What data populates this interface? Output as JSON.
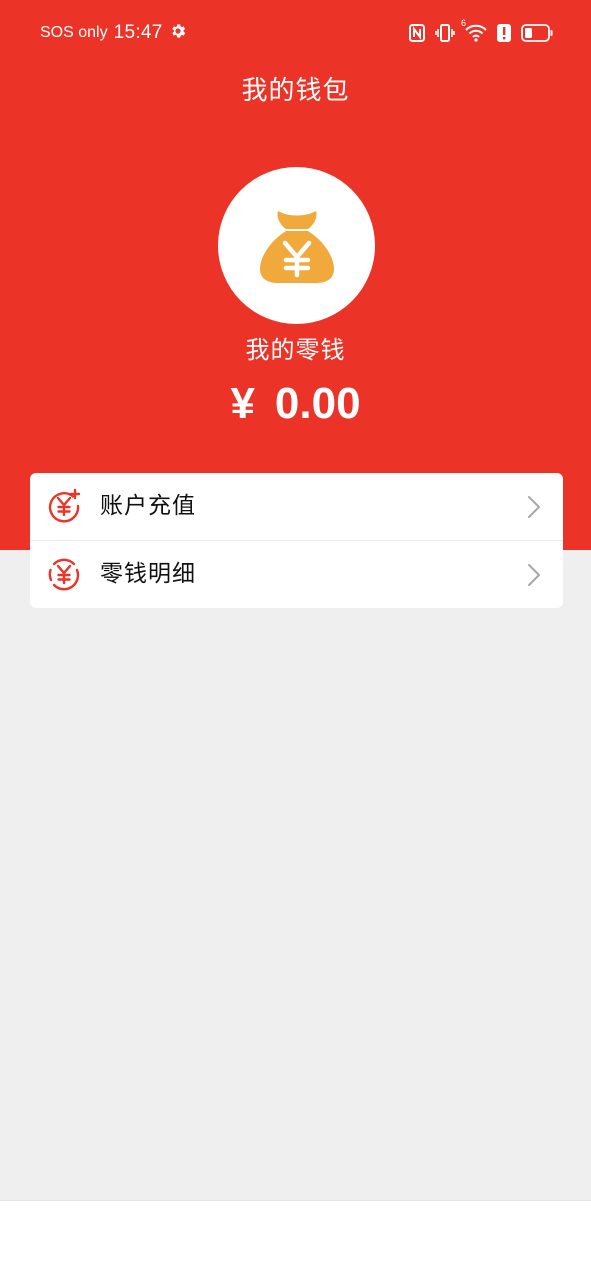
{
  "status_bar": {
    "carrier": "SOS only",
    "time": "15:47",
    "network_superscript": "6"
  },
  "header": {
    "title": "我的钱包"
  },
  "wallet": {
    "label": "我的零钱",
    "currency_symbol": "¥",
    "balance": "0.00"
  },
  "menu": {
    "items": [
      {
        "label": "账户充值",
        "icon": "yen-plus-icon"
      },
      {
        "label": "零钱明细",
        "icon": "yen-circle-icon"
      }
    ]
  },
  "colors": {
    "primary_red": "#eb3427",
    "bag_orange": "#f2a93b",
    "background": "#efefef",
    "card": "#ffffff"
  }
}
